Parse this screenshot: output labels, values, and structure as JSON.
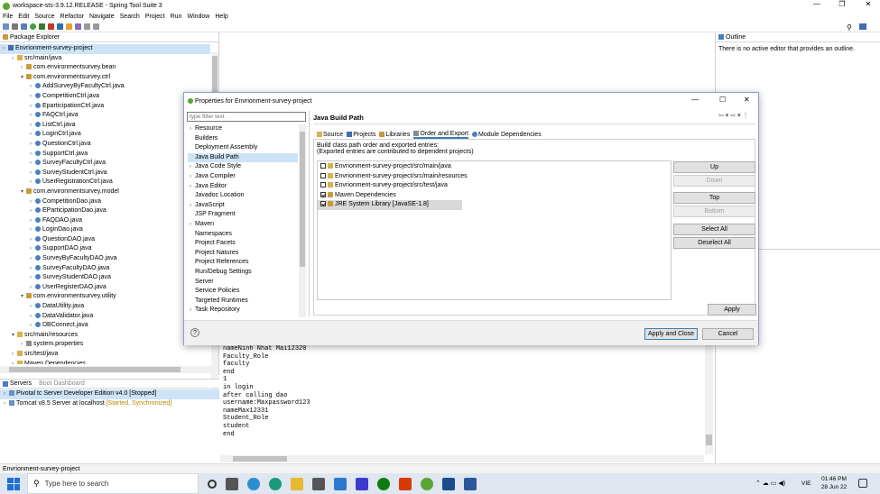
{
  "window": {
    "title": "workspace-sts-3.9.12.RELEASE - Spring Tool Suite 3",
    "min": "—",
    "max": "❐",
    "close": "✕"
  },
  "menu": [
    "File",
    "Edit",
    "Source",
    "Refactor",
    "Navigate",
    "Search",
    "Project",
    "Run",
    "Window",
    "Help"
  ],
  "package_explorer": {
    "tab_label": "Package Explorer",
    "items": [
      {
        "depth": 0,
        "icon": "proj",
        "label": "Envrionment-survey-project",
        "sel": true
      },
      {
        "depth": 1,
        "icon": "fold",
        "label": "src/main/java"
      },
      {
        "depth": 2,
        "icon": "pkg",
        "label": "com.environmentsurvey.bean"
      },
      {
        "depth": 2,
        "icon": "pkg",
        "label": "com.environmentsurvey.ctrl",
        "open": true
      },
      {
        "depth": 3,
        "icon": "java",
        "label": "AddSurveyByFacultyCtrl.java"
      },
      {
        "depth": 3,
        "icon": "java",
        "label": "CompetitionCtrl.java"
      },
      {
        "depth": 3,
        "icon": "java",
        "label": "EparticipationCtrl.java"
      },
      {
        "depth": 3,
        "icon": "java",
        "label": "FAQCtrl.java"
      },
      {
        "depth": 3,
        "icon": "java",
        "label": "ListCtrl.java"
      },
      {
        "depth": 3,
        "icon": "java",
        "label": "LoginCtrl.java"
      },
      {
        "depth": 3,
        "icon": "java",
        "label": "QuestionCtrl.java"
      },
      {
        "depth": 3,
        "icon": "java",
        "label": "SupportCtrl.java"
      },
      {
        "depth": 3,
        "icon": "java",
        "label": "SurveyFacultyCtrl.java"
      },
      {
        "depth": 3,
        "icon": "java",
        "label": "SurveyStudentCtrl.java"
      },
      {
        "depth": 3,
        "icon": "java",
        "label": "UserRegistrationCtrl.java"
      },
      {
        "depth": 2,
        "icon": "pkg",
        "label": "com.environmentsurvey.model",
        "open": true
      },
      {
        "depth": 3,
        "icon": "java",
        "label": "CompetitionDao.java"
      },
      {
        "depth": 3,
        "icon": "java",
        "label": "EParticipationDao.java"
      },
      {
        "depth": 3,
        "icon": "java",
        "label": "FAQDAO.java"
      },
      {
        "depth": 3,
        "icon": "java",
        "label": "LoginDao.java"
      },
      {
        "depth": 3,
        "icon": "java",
        "label": "QuestionDAO.java"
      },
      {
        "depth": 3,
        "icon": "java",
        "label": "SupportDAO.java"
      },
      {
        "depth": 3,
        "icon": "java",
        "label": "SurveyByFacultyDAO.java"
      },
      {
        "depth": 3,
        "icon": "java",
        "label": "SurveyFacultyDAO.java"
      },
      {
        "depth": 3,
        "icon": "java",
        "label": "SurveyStudentDAO.java"
      },
      {
        "depth": 3,
        "icon": "java",
        "label": "UserRegisterDAO.java"
      },
      {
        "depth": 2,
        "icon": "pkg",
        "label": "com.environmentsurvey.utility",
        "open": true
      },
      {
        "depth": 3,
        "icon": "java",
        "label": "DataUtility.java"
      },
      {
        "depth": 3,
        "icon": "java",
        "label": "DataValidator.java"
      },
      {
        "depth": 3,
        "icon": "java",
        "label": "DBConnect.java"
      },
      {
        "depth": 1,
        "icon": "fold",
        "label": "src/main/resources",
        "open": true
      },
      {
        "depth": 2,
        "icon": "prop",
        "label": "system.properties"
      },
      {
        "depth": 1,
        "icon": "fold",
        "label": "src/test/java"
      },
      {
        "depth": 1,
        "icon": "fold",
        "label": "Maven Dependencies"
      }
    ]
  },
  "servers": {
    "tab_label": "Servers",
    "tab2_label": "Boot Dashboard",
    "items": [
      {
        "label": "Pivotal tc Server Developer Edition v4.0",
        "status": "[Stopped]",
        "sel": true
      },
      {
        "label": "Tomcat v8.5 Server at localhost",
        "status": "[Started, Synchronized]"
      }
    ]
  },
  "outline": {
    "tab_label": "Outline",
    "message": "There is no active editor that provides an outline."
  },
  "console_lines": [
    "nameNinh Nhat Mai12320",
    "Faculty_Role",
    "faculty",
    "end",
    "1",
    "in login",
    "after calling dao",
    "username:Maxpassword123",
    "nameMax12331",
    "Student_Role",
    "student",
    "end"
  ],
  "dialog": {
    "title": "Properties for Envrionment-survey-project",
    "filter_placeholder": "type filter text",
    "nav": [
      {
        "label": "Resource",
        "expand": true
      },
      {
        "label": "Builders"
      },
      {
        "label": "Deployment Assembly"
      },
      {
        "label": "Java Build Path",
        "sel": true
      },
      {
        "label": "Java Code Style",
        "expand": true
      },
      {
        "label": "Java Compiler",
        "expand": true
      },
      {
        "label": "Java Editor",
        "expand": true
      },
      {
        "label": "Javadoc Location"
      },
      {
        "label": "JavaScript",
        "expand": true
      },
      {
        "label": "JSP Fragment"
      },
      {
        "label": "Maven",
        "expand": true
      },
      {
        "label": "Namespaces"
      },
      {
        "label": "Project Facets"
      },
      {
        "label": "Project Natures"
      },
      {
        "label": "Project References"
      },
      {
        "label": "Run/Debug Settings"
      },
      {
        "label": "Server"
      },
      {
        "label": "Service Policies"
      },
      {
        "label": "Targeted Runtimes"
      },
      {
        "label": "Task Repository",
        "expand": true
      }
    ],
    "page_title": "Java Build Path",
    "tabs": [
      "Source",
      "Projects",
      "Libraries",
      "Order and Export",
      "Module Dependencies"
    ],
    "active_tab": "Order and Export",
    "desc1": "Build class path order and exported entries:",
    "desc2": "(Exported entries are contributed to dependent projects)",
    "entries": [
      {
        "label": "Envrionment-survey-project/src/main/java",
        "checked": false,
        "icon": "fold"
      },
      {
        "label": "Envrionment-survey-project/src/main/resources",
        "checked": false,
        "icon": "fold"
      },
      {
        "label": "Envrionment-survey-project/src/test/java",
        "checked": false,
        "icon": "fold"
      },
      {
        "label": "Maven Dependencies",
        "checked": true,
        "icon": "pkg"
      },
      {
        "label": "JRE System Library [JavaSE-1.8]",
        "checked": true,
        "icon": "pkg",
        "sel": true
      }
    ],
    "buttons": {
      "up": "Up",
      "down": "Down",
      "top": "Top",
      "bottom": "Bottom",
      "select_all": "Select All",
      "deselect_all": "Deselect All",
      "apply": "Apply",
      "apply_close": "Apply and Close",
      "cancel": "Cancel"
    }
  },
  "status_bar": "Envrionment-survey-project",
  "taskbar": {
    "search_placeholder": "Type here to search",
    "time": "01:46 PM",
    "date": "28 Jun 22",
    "lang": "VIE"
  }
}
